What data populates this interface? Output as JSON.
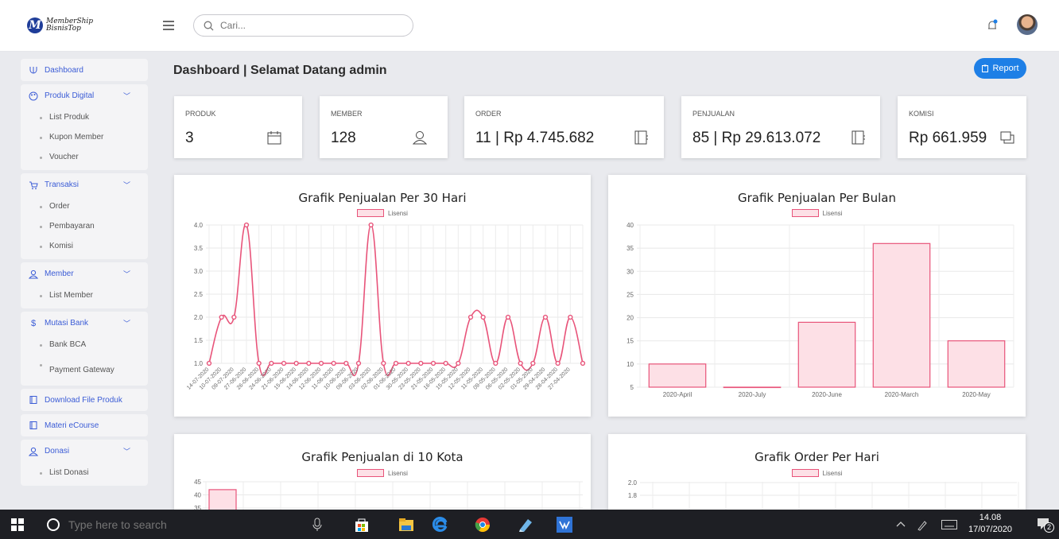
{
  "app": {
    "logo_top": "MemberShip",
    "logo_bottom": "BisnisTop",
    "logo_letter": "M"
  },
  "search": {
    "placeholder": "Cari..."
  },
  "sidebar": {
    "dashboard": "Dashboard",
    "produk": {
      "label": "Produk Digital",
      "items": [
        "List Produk",
        "Kupon Member",
        "Voucher"
      ]
    },
    "transaksi": {
      "label": "Transaksi",
      "items": [
        "Order",
        "Pembayaran",
        "Komisi"
      ]
    },
    "member": {
      "label": "Member",
      "items": [
        "List Member"
      ]
    },
    "mutasi": {
      "label": "Mutasi Bank",
      "items": [
        "Bank BCA",
        "Payment Gateway"
      ]
    },
    "download": "Download File Produk",
    "materi": "Materi eCourse",
    "donasi": {
      "label": "Donasi",
      "items": [
        "List Donasi"
      ]
    }
  },
  "header": {
    "title": "Dashboard | Selamat Datang admin",
    "report": "Report"
  },
  "stats": [
    {
      "label": "PRODUK",
      "value": "3"
    },
    {
      "label": "MEMBER",
      "value": "128"
    },
    {
      "label": "ORDER",
      "value": "11 | Rp 4.745.682"
    },
    {
      "label": "PENJUALAN",
      "value": "85 | Rp 29.613.072"
    },
    {
      "label": "KOMISI",
      "value": "Rp 661.959"
    }
  ],
  "legend_label": "Lisensi",
  "colors": {
    "accent": "#1e7fe6",
    "series_line": "#e8547a",
    "series_fill": "#fde0e6",
    "sidebar_link": "#3b5cd6"
  },
  "chart_data": [
    {
      "type": "line",
      "title": "Grafik Penjualan Per 30 Hari",
      "series": [
        {
          "name": "Lisensi",
          "values": [
            1,
            2,
            2,
            4,
            1,
            1,
            1,
            1,
            1,
            1,
            1,
            1,
            1,
            4,
            1,
            1,
            1,
            1,
            1,
            1,
            1,
            2,
            2,
            1,
            2,
            1,
            1,
            2,
            1,
            2,
            1
          ]
        }
      ],
      "x": [
        "14-07-2020",
        "10-07-2020",
        "09-07-2020",
        "27-06-2020",
        "26-06-2020",
        "24-06-2020",
        "21-06-2020",
        "15-06-2020",
        "14-06-2020",
        "12-06-2020",
        "11-06-2020",
        "10-06-2020",
        "09-06-2020",
        "03-06-2020",
        "02-06-2020",
        "01-06-2020",
        "30-05-2020",
        "23-05-2020",
        "21-05-2020",
        "16-05-2020",
        "15-05-2020",
        "12-05-2020",
        "11-05-2020",
        "09-05-2020",
        "06-05-2020",
        "02-05-2020",
        "01-05-2020",
        "29-04-2020",
        "28-04-2020",
        "27-04-2020"
      ],
      "yticks": [
        "1.0",
        "1.5",
        "2.0",
        "2.5",
        "3.0",
        "3.5",
        "4.0"
      ],
      "ylim": [
        1,
        4
      ]
    },
    {
      "type": "bar",
      "title": "Grafik Penjualan Per Bulan",
      "categories": [
        "2020-April",
        "2020-July",
        "2020-June",
        "2020-March",
        "2020-May"
      ],
      "series": [
        {
          "name": "Lisensi",
          "values": [
            10,
            5,
            19,
            36,
            15
          ]
        }
      ],
      "yticks": [
        "5",
        "10",
        "15",
        "20",
        "25",
        "30",
        "35",
        "40"
      ],
      "ylim": [
        5,
        40
      ]
    },
    {
      "type": "bar",
      "title": "Grafik Penjualan di 10 Kota",
      "series": [
        {
          "name": "Lisensi",
          "values": [
            42
          ]
        }
      ],
      "yticks": [
        "35",
        "40",
        "45"
      ],
      "ylim": [
        35,
        45
      ]
    },
    {
      "type": "line",
      "title": "Grafik Order Per Hari",
      "series": [
        {
          "name": "Lisensi",
          "values": []
        }
      ],
      "yticks": [
        "1.8",
        "2.0"
      ]
    }
  ],
  "taskbar": {
    "search_placeholder": "Type here to search",
    "time": "14.08",
    "date": "17/07/2020",
    "notif_count": "2"
  }
}
